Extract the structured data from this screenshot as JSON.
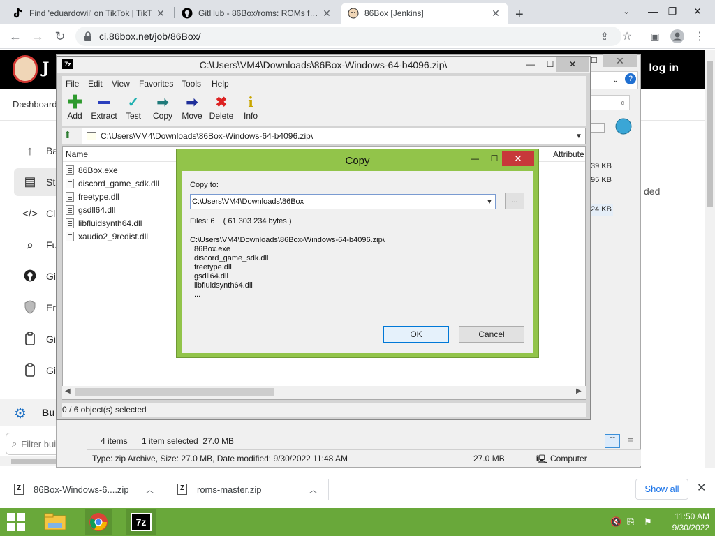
{
  "browser": {
    "tabs": [
      {
        "title": "Find 'eduardowii' on TikTok | TikT",
        "active": false
      },
      {
        "title": "GitHub - 86Box/roms: ROMs for t",
        "active": false
      },
      {
        "title": "86Box [Jenkins]",
        "active": true
      }
    ],
    "new_tab_label": "+",
    "url": "ci.86box.net/job/86Box/"
  },
  "jenkins": {
    "logo_text": "J",
    "login_label": "log in",
    "breadcrumb": "Dashboard",
    "sidebar": [
      {
        "icon": "arrow-up-icon",
        "label": "Ba"
      },
      {
        "icon": "document-icon",
        "label": "St"
      },
      {
        "icon": "code-icon",
        "label": "Cl"
      },
      {
        "icon": "search-icon",
        "label": "Fu"
      },
      {
        "icon": "github-icon",
        "label": "Gi"
      },
      {
        "icon": "shield-icon",
        "label": "Er"
      },
      {
        "icon": "clipboard-icon",
        "label": "Gi"
      },
      {
        "icon": "clipboard-icon",
        "label": "Gi"
      }
    ],
    "build_history_label": "Bu",
    "filter_placeholder": "Filter builds...",
    "right_text": "ded"
  },
  "bg_window": {
    "status_count": "4 items",
    "status_selected": "1 item selected  27.0 MB",
    "details": "Type: zip Archive, Size: 27.0 MB, Date modified: 9/30/2022 11:48 AM",
    "details_size": "27.0 MB",
    "details_location": "Computer",
    "sizes": [
      "39 KB",
      "95 KB",
      "24 KB"
    ]
  },
  "sevenzip": {
    "title": "C:\\Users\\VM4\\Downloads\\86Box-Windows-64-b4096.zip\\",
    "icon_text": "7z",
    "menu": [
      "File",
      "Edit",
      "View",
      "Favorites",
      "Tools",
      "Help"
    ],
    "toolbar": [
      {
        "label": "Add",
        "glyph": "+",
        "color": "#2e9a2e"
      },
      {
        "label": "Extract",
        "glyph": "−",
        "color": "#2b3fbd"
      },
      {
        "label": "Test",
        "glyph": "✔",
        "color": "#1fa6a6"
      },
      {
        "label": "Copy",
        "glyph": "⇒",
        "color": "#1f7a7a"
      },
      {
        "label": "Move",
        "glyph": "➔",
        "color": "#1f2f9a"
      },
      {
        "label": "Delete",
        "glyph": "✖",
        "color": "#d22"
      },
      {
        "label": "Info",
        "glyph": "i",
        "color": "#c9a600"
      }
    ],
    "address": "C:\\Users\\VM4\\Downloads\\86Box-Windows-64-b4096.zip\\",
    "columns": {
      "name": "Name",
      "attributes": "Attribute"
    },
    "files": [
      "86Box.exe",
      "discord_game_sdk.dll",
      "freetype.dll",
      "gsdll64.dll",
      "libfluidsynth64.dll",
      "xaudio2_9redist.dll"
    ],
    "status": "0 / 6 object(s) selected"
  },
  "copy_dialog": {
    "title": "Copy",
    "copy_to_label": "Copy to:",
    "destination": "C:\\Users\\VM4\\Downloads\\86Box",
    "browse_label": "...",
    "files_summary": "Files: 6    ( 61 303 234 bytes )",
    "source_path": "C:\\Users\\VM4\\Downloads\\86Box-Windows-64-b4096.zip\\",
    "listed_files": [
      "86Box.exe",
      "discord_game_sdk.dll",
      "freetype.dll",
      "gsdll64.dll",
      "libfluidsynth64.dll",
      "..."
    ],
    "ok_label": "OK",
    "cancel_label": "Cancel"
  },
  "downloads": {
    "items": [
      "86Box-Windows-6....zip",
      "roms-master.zip"
    ],
    "show_all_label": "Show all"
  },
  "taskbar": {
    "time": "11:50 AM",
    "date": "9/30/2022",
    "apps": [
      "file-explorer-icon",
      "chrome-icon",
      "7zip-icon"
    ],
    "app_7z_text": "7z"
  }
}
